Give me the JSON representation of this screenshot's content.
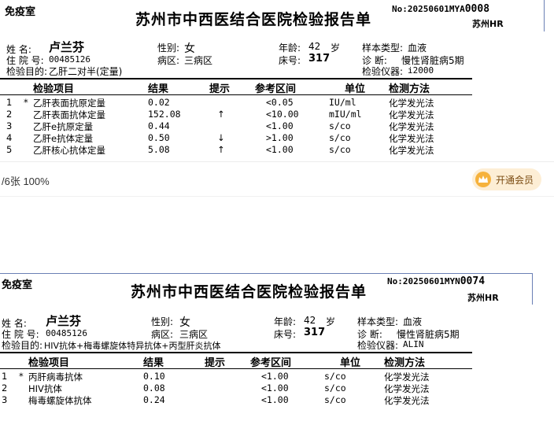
{
  "viewer": {
    "page_info": "/6张  100%",
    "vip_button": "开通会员",
    "vip_icon": "crown-icon"
  },
  "reports": [
    {
      "dept": "免疫室",
      "title": "苏州市中西医结合医院检验报告单",
      "no_label": "No:",
      "no_main": "20250601MYA",
      "no_tail": "0008",
      "hosp": "苏州HR",
      "name_label": "姓    名:",
      "name": "卢兰芬",
      "gender_label": "性别:",
      "gender": "女",
      "age_label": "年龄:",
      "age": "42",
      "age_unit": "岁",
      "sample_label": "样本类型:",
      "sample": "血液",
      "inpatient_label": "住 院 号:",
      "inpatient": "00485126",
      "ward_label": "病区:",
      "ward": "三病区",
      "bed_label": "床号:",
      "bed": "317",
      "diag_label": "诊      断:",
      "diag": "慢性肾脏病5期",
      "purpose_label": "检验目的:",
      "purpose": "乙肝二对半(定量)",
      "instrument_label": "检验仪器:",
      "instrument": "i2000",
      "headers": [
        "检验项目",
        "结果",
        "提示",
        "参考区间",
        "单位",
        "检测方法"
      ],
      "rows": [
        {
          "no": "1",
          "star": "*",
          "item": "乙肝表面抗原定量",
          "result": "0.02",
          "flag": "",
          "ref": "<0.05",
          "unit": "IU/ml",
          "method": "化学发光法"
        },
        {
          "no": "2",
          "star": "",
          "item": "乙肝表面抗体定量",
          "result": "152.08",
          "flag": "↑",
          "ref": "<10.00",
          "unit": "mIU/ml",
          "method": "化学发光法"
        },
        {
          "no": "3",
          "star": "",
          "item": "乙肝e抗原定量",
          "result": "0.44",
          "flag": "",
          "ref": "<1.00",
          "unit": "s/co",
          "method": "化学发光法"
        },
        {
          "no": "4",
          "star": "",
          "item": "乙肝e抗体定量",
          "result": "0.50",
          "flag": "↓",
          "ref": ">1.00",
          "unit": "s/co",
          "method": "化学发光法"
        },
        {
          "no": "5",
          "star": "",
          "item": "乙肝核心抗体定量",
          "result": "5.08",
          "flag": "↑",
          "ref": "<1.00",
          "unit": "s/co",
          "method": "化学发光法"
        }
      ]
    },
    {
      "dept": "免疫室",
      "title": "苏州市中西医结合医院检验报告单",
      "no_label": "No:",
      "no_main": "20250601MYN",
      "no_tail": "0074",
      "hosp": "苏州HR",
      "name_label": "姓    名:",
      "name": "卢兰芬",
      "gender_label": "性别:",
      "gender": "女",
      "age_label": "年龄:",
      "age": "42",
      "age_unit": "岁",
      "sample_label": "样本类型:",
      "sample": "血液",
      "inpatient_label": "住 院 号:",
      "inpatient": "00485126",
      "ward_label": "病区:",
      "ward": "三病区",
      "bed_label": "床号:",
      "bed": "317",
      "diag_label": "诊      断:",
      "diag": "慢性肾脏病5期",
      "purpose_label": "检验目的:",
      "purpose": "HIV抗体+梅毒螺旋体特异抗体+丙型肝炎抗体",
      "instrument_label": "检验仪器:",
      "instrument": "ALIN",
      "headers": [
        "检验项目",
        "结果",
        "提示",
        "参考区间",
        "单位",
        "检测方法"
      ],
      "rows": [
        {
          "no": "1",
          "star": "*",
          "item": "丙肝病毒抗体",
          "result": "0.10",
          "flag": "",
          "ref": "<1.00",
          "unit": "s/co",
          "method": "化学发光法"
        },
        {
          "no": "2",
          "star": "",
          "item": "HIV抗体",
          "result": "0.08",
          "flag": "",
          "ref": "<1.00",
          "unit": "s/co",
          "method": "化学发光法"
        },
        {
          "no": "3",
          "star": "",
          "item": "梅毒螺旋体抗体",
          "result": "0.24",
          "flag": "",
          "ref": "<1.00",
          "unit": "s/co",
          "method": "化学发光法"
        }
      ]
    }
  ]
}
